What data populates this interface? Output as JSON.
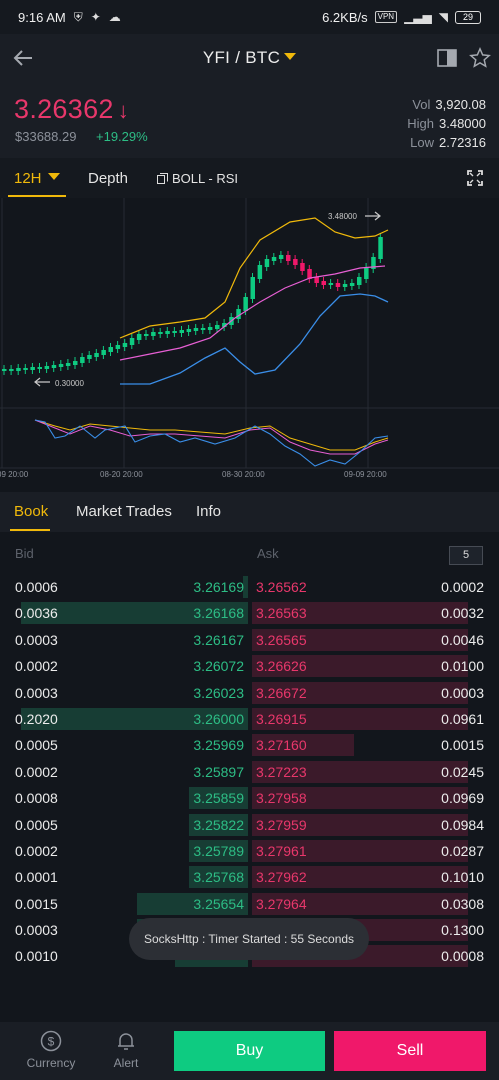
{
  "status_bar": {
    "time": "9:16 AM",
    "net_speed": "6.2KB/s",
    "vpn": "VPN",
    "battery": "29"
  },
  "header": {
    "pair": "YFI / BTC"
  },
  "ticker": {
    "last_price": "3.26362",
    "usd_price": "$33688.29",
    "change": "+19.29%",
    "vol_label": "Vol",
    "vol_value": "3,920.08",
    "high_label": "High",
    "high_value": "3.48000",
    "low_label": "Low",
    "low_value": "2.72316",
    "colors": {
      "down": "#e8376b",
      "up": "#2dbd85"
    }
  },
  "chart_toolbar": {
    "interval": "12H",
    "depth": "Depth",
    "indicators": "BOLL - RSI"
  },
  "chart": {
    "high_marker": "3.48000",
    "low_marker": "0.30000",
    "dates": [
      "09 20:00",
      "08-20 20:00",
      "08-30 20:00",
      "09-09 20:00"
    ]
  },
  "book_tabs": [
    "Book",
    "Market Trades",
    "Info"
  ],
  "order_book": {
    "bid_label": "Bid",
    "ask_label": "Ask",
    "depth_value": "5",
    "rows": [
      {
        "bid_qty": "0.0006",
        "bid_price": "3.26169",
        "ask_price": "3.26562",
        "ask_qty": "0.0002",
        "bid_depth": 0.02,
        "ask_depth": 0.0
      },
      {
        "bid_qty": "0.0036",
        "bid_price": "3.26168",
        "ask_price": "3.26563",
        "ask_qty": "0.0032",
        "bid_depth": 0.96,
        "ask_depth": 0.93
      },
      {
        "bid_qty": "0.0003",
        "bid_price": "3.26167",
        "ask_price": "3.26565",
        "ask_qty": "0.0046",
        "bid_depth": 0.0,
        "ask_depth": 0.93
      },
      {
        "bid_qty": "0.0002",
        "bid_price": "3.26072",
        "ask_price": "3.26626",
        "ask_qty": "0.0100",
        "bid_depth": 0.0,
        "ask_depth": 0.93
      },
      {
        "bid_qty": "0.0003",
        "bid_price": "3.26023",
        "ask_price": "3.26672",
        "ask_qty": "0.0003",
        "bid_depth": 0.0,
        "ask_depth": 0.93
      },
      {
        "bid_qty": "0.2020",
        "bid_price": "3.26000",
        "ask_price": "3.26915",
        "ask_qty": "0.0961",
        "bid_depth": 0.96,
        "ask_depth": 0.93
      },
      {
        "bid_qty": "0.0005",
        "bid_price": "3.25969",
        "ask_price": "3.27160",
        "ask_qty": "0.0015",
        "bid_depth": 0.0,
        "ask_depth": 0.44
      },
      {
        "bid_qty": "0.0002",
        "bid_price": "3.25897",
        "ask_price": "3.27223",
        "ask_qty": "0.0245",
        "bid_depth": 0.0,
        "ask_depth": 0.93
      },
      {
        "bid_qty": "0.0008",
        "bid_price": "3.25859",
        "ask_price": "3.27958",
        "ask_qty": "0.0969",
        "bid_depth": 0.25,
        "ask_depth": 0.93
      },
      {
        "bid_qty": "0.0005",
        "bid_price": "3.25822",
        "ask_price": "3.27959",
        "ask_qty": "0.0984",
        "bid_depth": 0.25,
        "ask_depth": 0.93
      },
      {
        "bid_qty": "0.0002",
        "bid_price": "3.25789",
        "ask_price": "3.27961",
        "ask_qty": "0.0287",
        "bid_depth": 0.25,
        "ask_depth": 0.93
      },
      {
        "bid_qty": "0.0001",
        "bid_price": "3.25768",
        "ask_price": "3.27962",
        "ask_qty": "0.1010",
        "bid_depth": 0.25,
        "ask_depth": 0.93
      },
      {
        "bid_qty": "0.0015",
        "bid_price": "3.25654",
        "ask_price": "3.27964",
        "ask_qty": "0.0308",
        "bid_depth": 0.47,
        "ask_depth": 0.93
      },
      {
        "bid_qty": "0.0003",
        "bid_price": "",
        "ask_price": "",
        "ask_qty": "0.1300",
        "bid_depth": 0.47,
        "ask_depth": 0.93
      },
      {
        "bid_qty": "0.0010",
        "bid_price": "",
        "ask_price": "",
        "ask_qty": "0.0008",
        "bid_depth": 0.31,
        "ask_depth": 0.93
      }
    ]
  },
  "toast": "SocksHttp : Timer Started : 55 Seconds",
  "bottom_bar": {
    "currency": "Currency",
    "alert": "Alert",
    "buy": "Buy",
    "sell": "Sell"
  }
}
